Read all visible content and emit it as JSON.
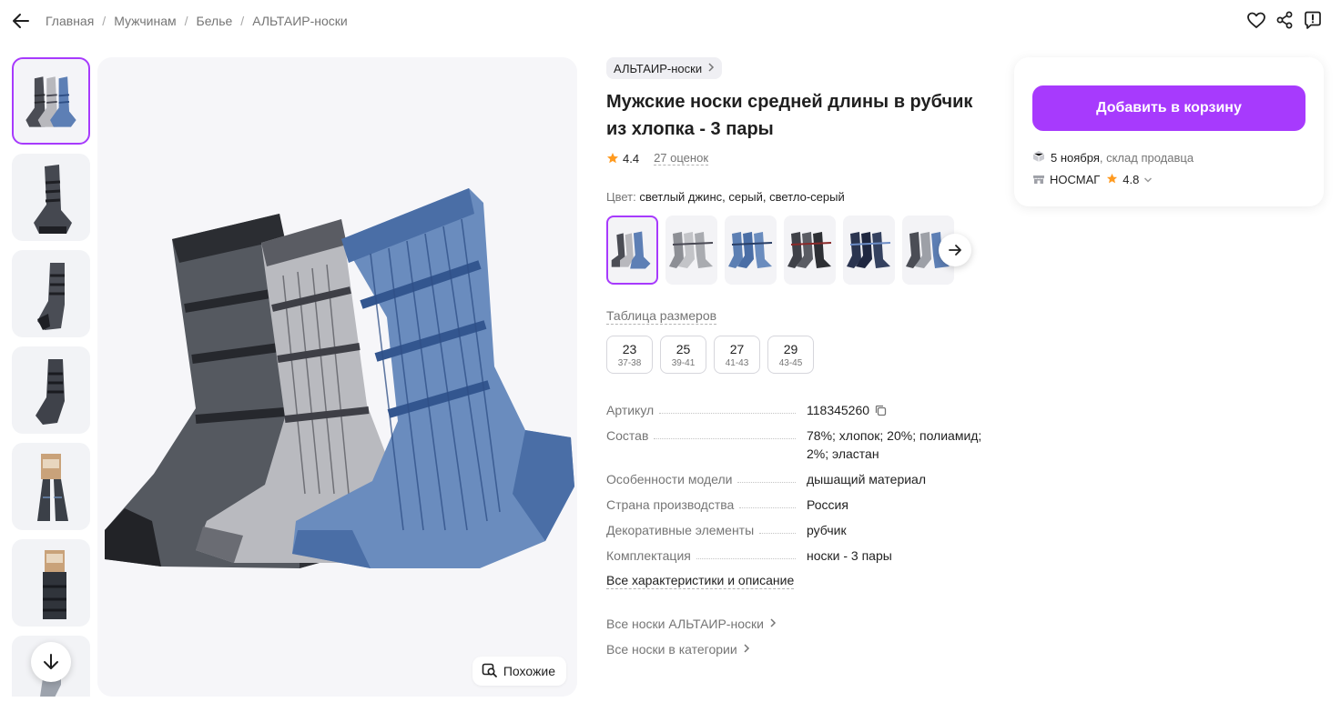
{
  "breadcrumbs": [
    "Главная",
    "Мужчинам",
    "Белье",
    "АЛЬТАИР-носки"
  ],
  "brand": "АЛЬТАИР-носки",
  "title": "Мужские носки средней длины в рубчик из хлопка - 3 пары",
  "rating": "4.4",
  "reviews": "27 оценок",
  "color_label": "Цвет:",
  "color_value": "светлый джинс, серый, светло-серый",
  "size_table_link": "Таблица размеров",
  "sizes": [
    {
      "size": "23",
      "range": "37-38"
    },
    {
      "size": "25",
      "range": "39-41"
    },
    {
      "size": "27",
      "range": "41-43"
    },
    {
      "size": "29",
      "range": "43-45"
    }
  ],
  "specs": [
    {
      "key": "Артикул",
      "value": "118345260"
    },
    {
      "key": "Состав",
      "value": "78%; хлопок; 20%; полиамид; 2%; эластан"
    },
    {
      "key": "Особенности модели",
      "value": "дышащий материал"
    },
    {
      "key": "Страна производства",
      "value": "Россия"
    },
    {
      "key": "Декоративные элементы",
      "value": "рубчик"
    },
    {
      "key": "Комплектация",
      "value": "носки - 3 пары"
    }
  ],
  "all_characteristics": "Все характеристики и описание",
  "more_links": [
    "Все носки АЛЬТАИР-носки",
    "Все носки в категории"
  ],
  "similar_button": "Похожие",
  "buy": {
    "add_to_cart": "Добавить в корзину",
    "delivery_date": "5 ноября",
    "delivery_from": ", склад продавца",
    "seller_name": "НОСМАГ",
    "seller_rating": "4.8"
  },
  "colors": {
    "accent": "#a73afd",
    "star": "#ff9a1f",
    "text_muted": "#757575"
  },
  "icons": {
    "back": "arrow-left-icon",
    "favorite": "heart-icon",
    "share": "share-icon",
    "report": "report-icon",
    "thumbs_down": "arrow-down-icon",
    "swatches_next": "arrow-right-icon",
    "similar": "image-search-icon",
    "copy": "copy-icon",
    "delivery": "box-icon",
    "seller": "store-icon"
  }
}
